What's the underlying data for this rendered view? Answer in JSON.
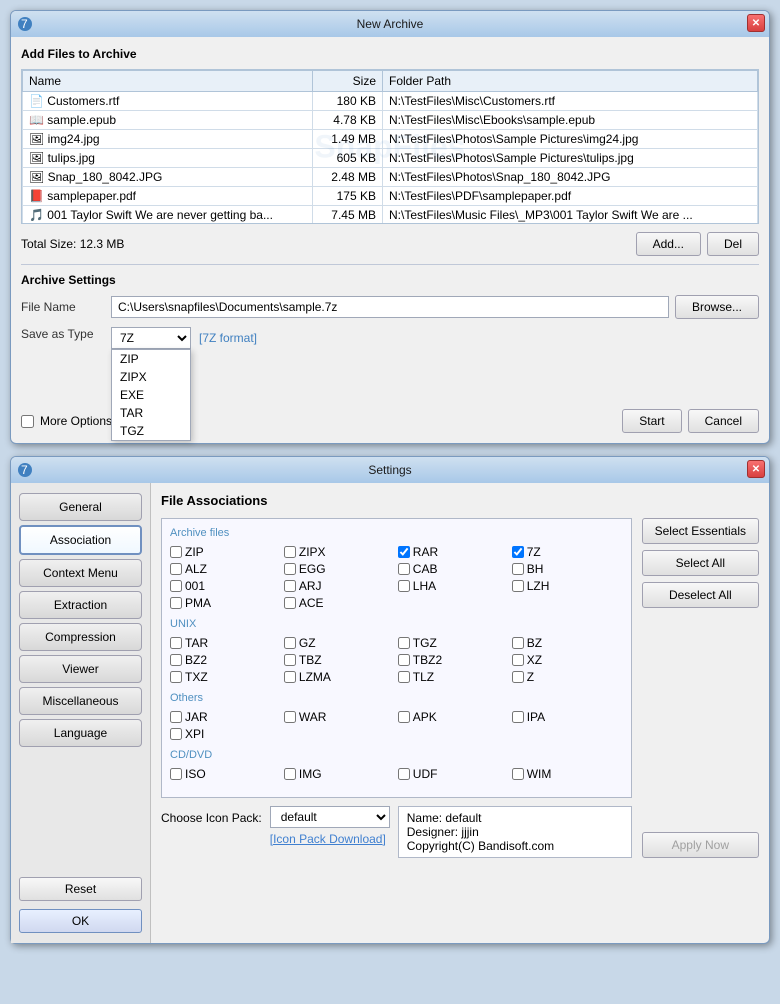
{
  "archive_window": {
    "title": "New Archive",
    "section": "Add Files to Archive",
    "columns": [
      "Name",
      "Size",
      "Folder Path"
    ],
    "files": [
      {
        "name": "Customers.rtf",
        "icon": "doc",
        "size": "180 KB",
        "path": "N:\\TestFiles\\Misc\\Customers.rtf"
      },
      {
        "name": "sample.epub",
        "icon": "epub",
        "size": "4.78 KB",
        "path": "N:\\TestFiles\\Misc\\Ebooks\\sample.epub"
      },
      {
        "name": "img24.jpg",
        "icon": "img",
        "size": "1.49 MB",
        "path": "N:\\TestFiles\\Photos\\Sample Pictures\\img24.jpg"
      },
      {
        "name": "tulips.jpg",
        "icon": "img",
        "size": "605 KB",
        "path": "N:\\TestFiles\\Photos\\Sample Pictures\\tulips.jpg"
      },
      {
        "name": "Snap_180_8042.JPG",
        "icon": "img",
        "size": "2.48 MB",
        "path": "N:\\TestFiles\\Photos\\Snap_180_8042.JPG"
      },
      {
        "name": "samplepaper.pdf",
        "icon": "pdf",
        "size": "175 KB",
        "path": "N:\\TestFiles\\PDF\\samplepaper.pdf"
      },
      {
        "name": "001 Taylor Swift We are never getting ba...",
        "icon": "music",
        "size": "7.45 MB",
        "path": "N:\\TestFiles\\Music Files\\_MP3\\001 Taylor Swift We are ..."
      }
    ],
    "total_size_label": "Total Size: 12.3 MB",
    "add_btn": "Add...",
    "del_btn": "Del",
    "archive_settings": "Archive Settings",
    "file_name_label": "File Name",
    "file_name_value": "C:\\Users\\snapfiles\\Documents\\sample.7z",
    "browse_btn": "Browse...",
    "save_as_type_label": "Save as Type",
    "save_as_type_value": "7Z",
    "format_hint": "[7Z format]",
    "save_types": [
      "ZIP",
      "ZIPX",
      "EXE",
      "TAR",
      "TGZ"
    ],
    "more_options": "More Options...",
    "start_btn": "Start",
    "cancel_btn": "Cancel"
  },
  "settings_window": {
    "title": "Settings",
    "sidebar": {
      "items": [
        {
          "label": "General",
          "active": false
        },
        {
          "label": "Association",
          "active": true
        },
        {
          "label": "Context Menu",
          "active": false
        },
        {
          "label": "Extraction",
          "active": false
        },
        {
          "label": "Compression",
          "active": false
        },
        {
          "label": "Viewer",
          "active": false
        },
        {
          "label": "Miscellaneous",
          "active": false
        },
        {
          "label": "Language",
          "active": false
        }
      ],
      "reset_btn": "Reset",
      "ok_btn": "OK"
    },
    "content": {
      "title": "File Associations",
      "archive_files_label": "Archive files",
      "archive_items": [
        {
          "label": "ZIP",
          "checked": false
        },
        {
          "label": "ZIPX",
          "checked": false
        },
        {
          "label": "RAR",
          "checked": true
        },
        {
          "label": "7Z",
          "checked": true
        },
        {
          "label": "ALZ",
          "checked": false
        },
        {
          "label": "EGG",
          "checked": false
        },
        {
          "label": "CAB",
          "checked": false
        },
        {
          "label": "BH",
          "checked": false
        },
        {
          "label": "001",
          "checked": false
        },
        {
          "label": "ARJ",
          "checked": false
        },
        {
          "label": "LHA",
          "checked": false
        },
        {
          "label": "LZH",
          "checked": false
        },
        {
          "label": "PMA",
          "checked": false
        },
        {
          "label": "ACE",
          "checked": false
        }
      ],
      "unix_label": "UNIX",
      "unix_items": [
        {
          "label": "TAR",
          "checked": false
        },
        {
          "label": "GZ",
          "checked": false
        },
        {
          "label": "TGZ",
          "checked": false
        },
        {
          "label": "BZ",
          "checked": false
        },
        {
          "label": "BZ2",
          "checked": false
        },
        {
          "label": "TBZ",
          "checked": false
        },
        {
          "label": "TBZ2",
          "checked": false
        },
        {
          "label": "XZ",
          "checked": false
        },
        {
          "label": "TXZ",
          "checked": false
        },
        {
          "label": "LZMA",
          "checked": false
        },
        {
          "label": "TLZ",
          "checked": false
        },
        {
          "label": "Z",
          "checked": false
        }
      ],
      "others_label": "Others",
      "others_items": [
        {
          "label": "JAR",
          "checked": false
        },
        {
          "label": "WAR",
          "checked": false
        },
        {
          "label": "APK",
          "checked": false
        },
        {
          "label": "IPA",
          "checked": false
        },
        {
          "label": "XPI",
          "checked": false
        }
      ],
      "cd_dvd_label": "CD/DVD",
      "cd_dvd_items": [
        {
          "label": "ISO",
          "checked": false
        },
        {
          "label": "IMG",
          "checked": false
        },
        {
          "label": "UDF",
          "checked": false
        },
        {
          "label": "WIM",
          "checked": false
        }
      ],
      "icon_pack_label": "Choose Icon Pack:",
      "icon_pack_value": "default",
      "icon_pack_info": {
        "name": "Name: default",
        "designer": "Designer: jjjin",
        "copyright": "Copyright(C) Bandisoft.com"
      },
      "icon_pack_download": "[Icon Pack Download]"
    },
    "right_actions": {
      "select_essentials": "Select Essentials",
      "select_all": "Select All",
      "deselect_all": "Deselect All",
      "apply_now": "Apply Now"
    }
  }
}
